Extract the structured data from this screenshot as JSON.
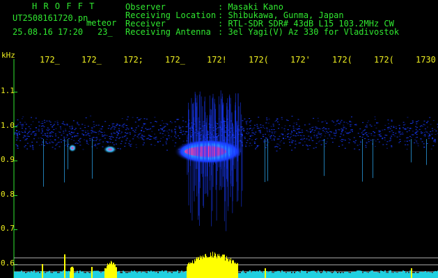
{
  "app": {
    "title": "H R O F F T",
    "filename": "UT2508161720.pn_",
    "filename_suffix": "meteor",
    "datetime": "25.08.16 17:20",
    "frame_number": "23_"
  },
  "header": {
    "labels": [
      "Observer",
      "Receiving Location",
      "Receiver",
      "Receiving Antenna"
    ],
    "values": [
      ": Masaki Kano",
      ": Shibukawa, Gunma, Japan",
      ": RTL-SDR SDR# 43dB L15 103.2MHz CW",
      ": 3el Yagi(V) Az 330 for Vladivostok"
    ]
  },
  "axes": {
    "y_unit": "kHz",
    "y_ticks": [
      "1.1",
      "1.0",
      "0.9",
      "0.8",
      "0.7",
      "0.6"
    ],
    "x_ticks": [
      "172_",
      "172_",
      "172;",
      "172_",
      "172!",
      "172(",
      "172'",
      "172(",
      "172(",
      "1730"
    ]
  },
  "colors": {
    "label_green": "#30e830",
    "tick_yellow": "#f0f020",
    "signal_yellow": "#ffff00",
    "signal_pink": "#ff3c9c",
    "noise_blue": "#1a3cff",
    "baseline_cyan": "#20d0e0",
    "grid_gray": "#b0b0b0"
  }
}
